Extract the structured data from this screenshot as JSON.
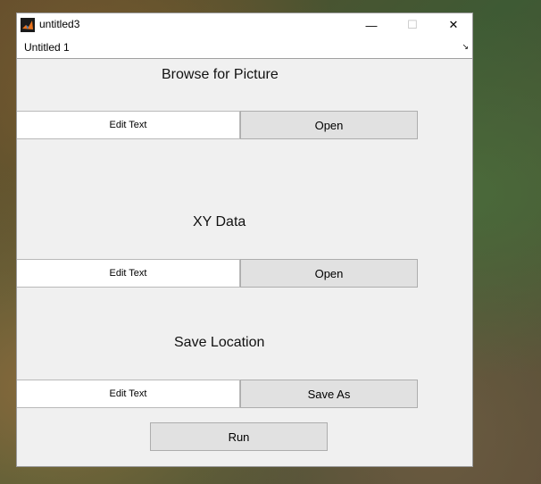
{
  "window": {
    "title": "untitled3",
    "controls": {
      "minimize": "—",
      "maximize": "☐",
      "close": "✕"
    }
  },
  "menubar": {
    "label": "Untitled 1",
    "dock_icon": "↘"
  },
  "sections": {
    "browse": {
      "heading": "Browse for Picture",
      "edit_text": "Edit Text",
      "button": "Open"
    },
    "xy": {
      "heading": "XY Data",
      "edit_text": "Edit Text",
      "button": "Open"
    },
    "save": {
      "heading": "Save Location",
      "edit_text": "Edit Text",
      "button": "Save As"
    }
  },
  "run_button": "Run"
}
